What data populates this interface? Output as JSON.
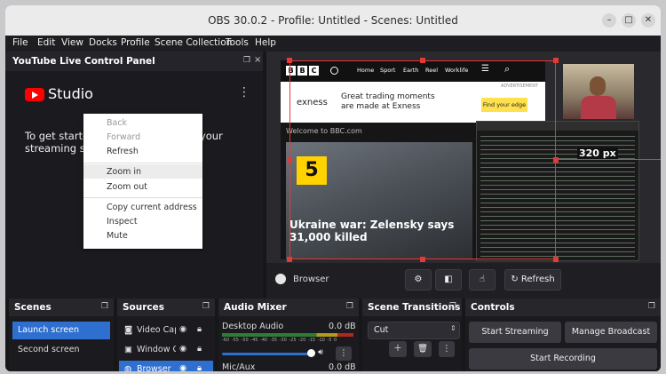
{
  "window": {
    "title": "OBS 30.0.2 - Profile: Untitled - Scenes: Untitled"
  },
  "menu": [
    "File",
    "Edit",
    "View",
    "Docks",
    "Profile",
    "Scene Collection",
    "Tools",
    "Help"
  ],
  "youtube_dock": {
    "title": "YouTube Live Control Panel",
    "logo_text": "Studio",
    "message": "To get started, start streaming on your streaming software"
  },
  "context_menu": [
    "Back",
    "Forward",
    "Refresh",
    "Zoom in",
    "Zoom out",
    "Copy current address",
    "Inspect",
    "Mute"
  ],
  "preview": {
    "bbc": {
      "nav": [
        "Home",
        "Sport",
        "Earth",
        "Reel",
        "Worklife"
      ],
      "ad_label": "ADVERTISEMENT",
      "ad_brand": "exness",
      "ad_text": "Great trading moments are made at Exness",
      "ad_button": "Find your edge",
      "welcome": "Welcome to BBC.com",
      "number": "5",
      "headline": "Ukraine war: Zelensky says 31,000 killed"
    },
    "size_label": "320 px"
  },
  "source_toolbar": {
    "source_name": "Browser",
    "refresh_label": "Refresh"
  },
  "scenes": {
    "title": "Scenes",
    "items": [
      "Launch screen",
      "Second screen"
    ]
  },
  "sources": {
    "title": "Sources",
    "items": [
      "Video Cap",
      "Window C",
      "Browser"
    ]
  },
  "mixer": {
    "title": "Audio Mixer",
    "channels": [
      {
        "name": "Desktop Audio",
        "level": "0.0 dB"
      },
      {
        "name": "Mic/Aux",
        "level": "0.0 dB"
      }
    ],
    "ticks": [
      "-60",
      "-55",
      "-50",
      "-45",
      "-40",
      "-35",
      "-30",
      "-25",
      "-20",
      "-15",
      "-10",
      "-5",
      "0"
    ]
  },
  "transitions": {
    "title": "Scene Transitions",
    "selected": "Cut"
  },
  "controls": {
    "title": "Controls",
    "start_streaming": "Start Streaming",
    "manage_broadcast": "Manage Broadcast",
    "start_recording": "Start Recording"
  },
  "colors": {
    "accent": "#2f6fd0",
    "selection": "#e53935",
    "bbc_number_bg": "#ffd200"
  }
}
